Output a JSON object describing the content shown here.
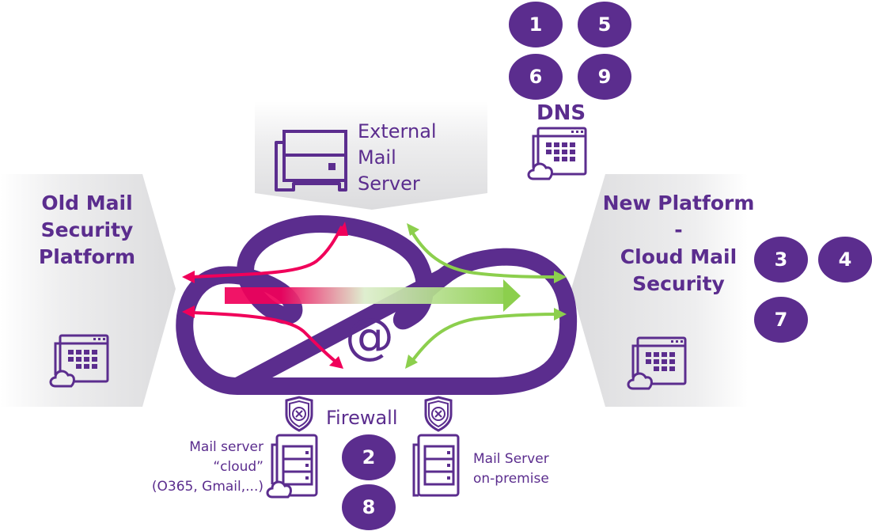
{
  "colors": {
    "brand_purple": "#5b2d8e",
    "old_flow_red": "#f0005a",
    "new_flow_green": "#8ccf4d",
    "panel_gray": "#e2e2e4"
  },
  "old_platform": {
    "title_lines": [
      "Old Mail",
      "Security",
      "Platform"
    ],
    "icon": "cloud-calendar-icon"
  },
  "new_platform": {
    "title_lines": [
      "New Platform",
      "-",
      "Cloud Mail",
      "Security"
    ],
    "icon": "cloud-calendar-icon",
    "steps": [
      "3",
      "4",
      "7"
    ]
  },
  "external_mail_server": {
    "label_lines": [
      "External",
      "Mail",
      "Server"
    ],
    "icon": "server-box-icon"
  },
  "dns": {
    "label": "DNS",
    "icon": "cloud-calendar-icon",
    "steps": [
      "1",
      "5",
      "6",
      "9"
    ]
  },
  "cloud": {
    "symbol": "@"
  },
  "firewall": {
    "label": "Firewall",
    "steps": [
      "2",
      "8"
    ]
  },
  "mail_server_cloud": {
    "label_lines": [
      "Mail server",
      "“cloud”",
      "(O365, Gmail,...)"
    ]
  },
  "mail_server_onprem": {
    "label_lines": [
      "Mail Server",
      "on-premise"
    ]
  }
}
